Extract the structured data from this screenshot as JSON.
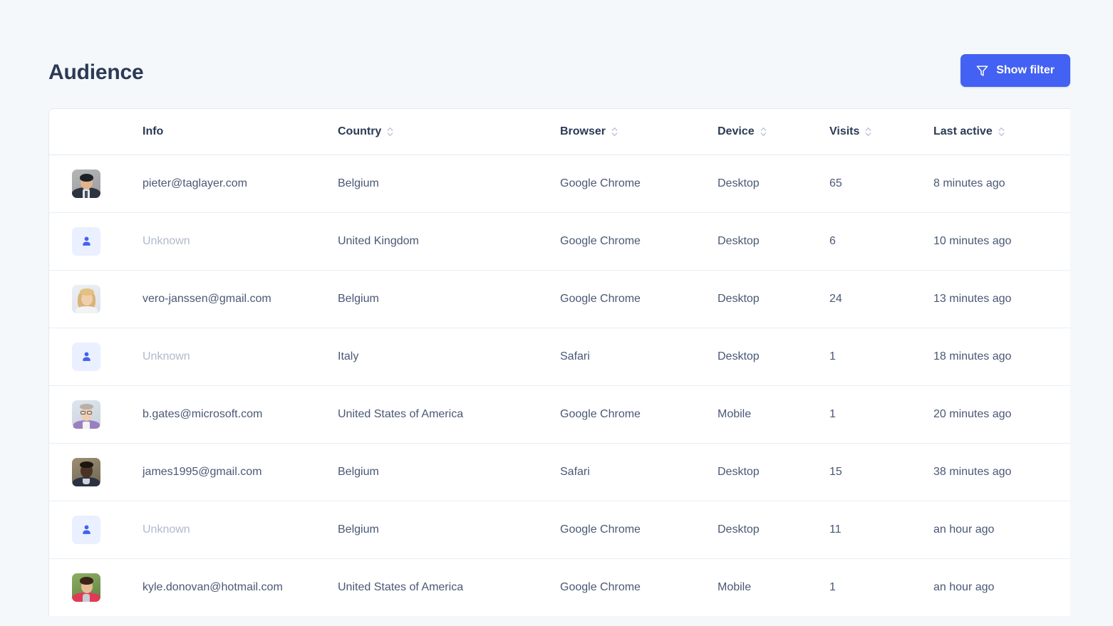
{
  "header": {
    "title": "Audience",
    "filter_button": {
      "label": "Show filter",
      "icon": "filter-icon",
      "color": "#4361f2"
    }
  },
  "table": {
    "columns": [
      {
        "key": "avatar",
        "label": "",
        "sortable": false
      },
      {
        "key": "info",
        "label": "Info",
        "sortable": false
      },
      {
        "key": "country",
        "label": "Country",
        "sortable": true
      },
      {
        "key": "browser",
        "label": "Browser",
        "sortable": true
      },
      {
        "key": "device",
        "label": "Device",
        "sortable": true
      },
      {
        "key": "visits",
        "label": "Visits",
        "sortable": true
      },
      {
        "key": "last",
        "label": "Last active",
        "sortable": true
      }
    ],
    "rows": [
      {
        "avatar": "photo",
        "avatar_style": "av1",
        "info": "pieter@taglayer.com",
        "unknown": false,
        "country": "Belgium",
        "browser": "Google Chrome",
        "device": "Desktop",
        "visits": "65",
        "last": "8 minutes ago"
      },
      {
        "avatar": "placeholder",
        "avatar_style": "",
        "info": "Unknown",
        "unknown": true,
        "country": "United Kingdom",
        "browser": "Google Chrome",
        "device": "Desktop",
        "visits": "6",
        "last": "10 minutes ago"
      },
      {
        "avatar": "photo",
        "avatar_style": "av3",
        "info": "vero-janssen@gmail.com",
        "unknown": false,
        "country": "Belgium",
        "browser": "Google Chrome",
        "device": "Desktop",
        "visits": "24",
        "last": "13 minutes ago"
      },
      {
        "avatar": "placeholder",
        "avatar_style": "",
        "info": "Unknown",
        "unknown": true,
        "country": "Italy",
        "browser": "Safari",
        "device": "Desktop",
        "visits": "1",
        "last": "18 minutes ago"
      },
      {
        "avatar": "photo",
        "avatar_style": "av5",
        "info": "b.gates@microsoft.com",
        "unknown": false,
        "country": "United States of America",
        "browser": "Google Chrome",
        "device": "Mobile",
        "visits": "1",
        "last": "20 minutes ago"
      },
      {
        "avatar": "photo",
        "avatar_style": "av6",
        "info": "james1995@gmail.com",
        "unknown": false,
        "country": "Belgium",
        "browser": "Safari",
        "device": "Desktop",
        "visits": "15",
        "last": "38 minutes ago"
      },
      {
        "avatar": "placeholder",
        "avatar_style": "",
        "info": "Unknown",
        "unknown": true,
        "country": "Belgium",
        "browser": "Google Chrome",
        "device": "Desktop",
        "visits": "11",
        "last": "an hour ago"
      },
      {
        "avatar": "photo",
        "avatar_style": "av8",
        "info": "kyle.donovan@hotmail.com",
        "unknown": false,
        "country": "United States of America",
        "browser": "Google Chrome",
        "device": "Mobile",
        "visits": "1",
        "last": "an hour ago"
      }
    ]
  },
  "colors": {
    "page_background": "#f5f8fb",
    "card_background": "#ffffff",
    "accent": "#4361f2",
    "title": "#2b3a55",
    "body_text": "#4a5875",
    "muted_text": "#b0b9cc",
    "border": "#e9eef6"
  }
}
